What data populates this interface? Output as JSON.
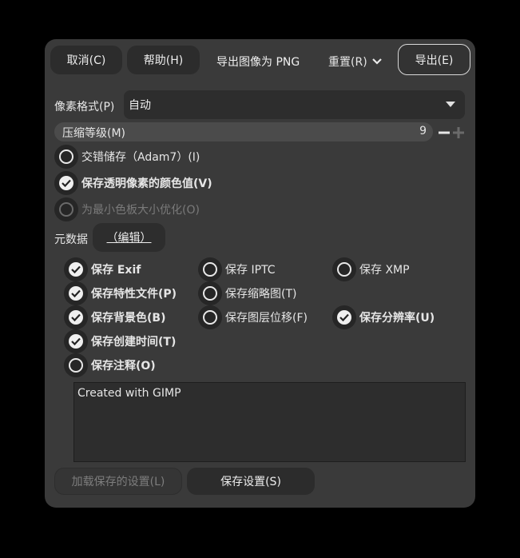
{
  "header": {
    "cancel_label": "取消(C)",
    "help_label": "帮助(H)",
    "title": "导出图像为 PNG",
    "reset_label": "重置(R)",
    "export_label": "导出(E)"
  },
  "pixel_format": {
    "label": "像素格式(P)",
    "value": "自动"
  },
  "compression": {
    "label": "压缩等级(M)",
    "value": "9",
    "level_fraction": 1.0
  },
  "options": {
    "interlace": {
      "label": "交错储存（Adam7）(I)",
      "checked": false
    },
    "save_transparent_color": {
      "label": "保存透明像素的颜色值(V)",
      "checked": true
    },
    "optimize_palette": {
      "label": "为最小色板大小优化(O)",
      "checked": false,
      "disabled": true
    }
  },
  "metadata": {
    "label": "元数据",
    "edit_label": "（编辑）",
    "items": {
      "exif": {
        "label": "保存 Exif",
        "checked": true
      },
      "iptc": {
        "label": "保存 IPTC",
        "checked": false
      },
      "xmp": {
        "label": "保存 XMP",
        "checked": false
      },
      "color_profile": {
        "label": "保存特性文件(P)",
        "checked": true
      },
      "thumbnail": {
        "label": "保存缩略图(T)",
        "checked": false
      },
      "background": {
        "label": "保存背景色(B)",
        "checked": true
      },
      "layer_offset": {
        "label": "保存图层位移(F)",
        "checked": false
      },
      "resolution": {
        "label": "保存分辨率(U)",
        "checked": true
      },
      "creation_time": {
        "label": "保存创建时间(T)",
        "checked": true
      },
      "comment": {
        "label": "保存注释(O)",
        "checked": false
      }
    },
    "comment_text": "Created with GIMP"
  },
  "footer": {
    "load_defaults_label": "加载保存的设置(L)",
    "save_defaults_label": "保存设置(S)"
  }
}
